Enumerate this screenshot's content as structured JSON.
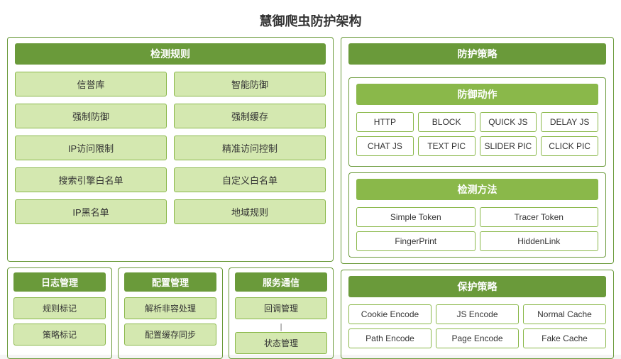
{
  "page": {
    "title": "慧御爬虫防护架构"
  },
  "detection_rules": {
    "header": "检测规则",
    "items": [
      "信誉库",
      "智能防御",
      "强制防御",
      "强制缓存",
      "IP访问限制",
      "精准访问控制",
      "搜索引擎白名单",
      "自定义白名单",
      "IP黑名单",
      "地域规则"
    ]
  },
  "log_management": {
    "header": "日志管理",
    "items": [
      "规则标记",
      "策略标记"
    ]
  },
  "config_management": {
    "header": "配置管理",
    "items": [
      "解析非容处理",
      "配置缓存同步"
    ]
  },
  "service_comm": {
    "header": "服务通信",
    "items": [
      "回调管理",
      "状态管理"
    ]
  },
  "defense_policy": {
    "header": "防护策略"
  },
  "defense_action": {
    "header": "防御动作",
    "items": [
      "HTTP",
      "BLOCK",
      "QUICK JS",
      "DELAY JS",
      "CHAT JS",
      "TEXT PIC",
      "SLIDER PIC",
      "CLICK PIC"
    ]
  },
  "detect_method": {
    "header": "检测方法",
    "items": [
      "Simple Token",
      "Tracer Token",
      "FingerPrint",
      "HiddenLink"
    ]
  },
  "protect_strategy": {
    "header": "保护策略",
    "items": [
      "Cookie Encode",
      "JS Encode",
      "Normal Cache",
      "Path Encode",
      "Page Encode",
      "Fake Cache"
    ]
  }
}
